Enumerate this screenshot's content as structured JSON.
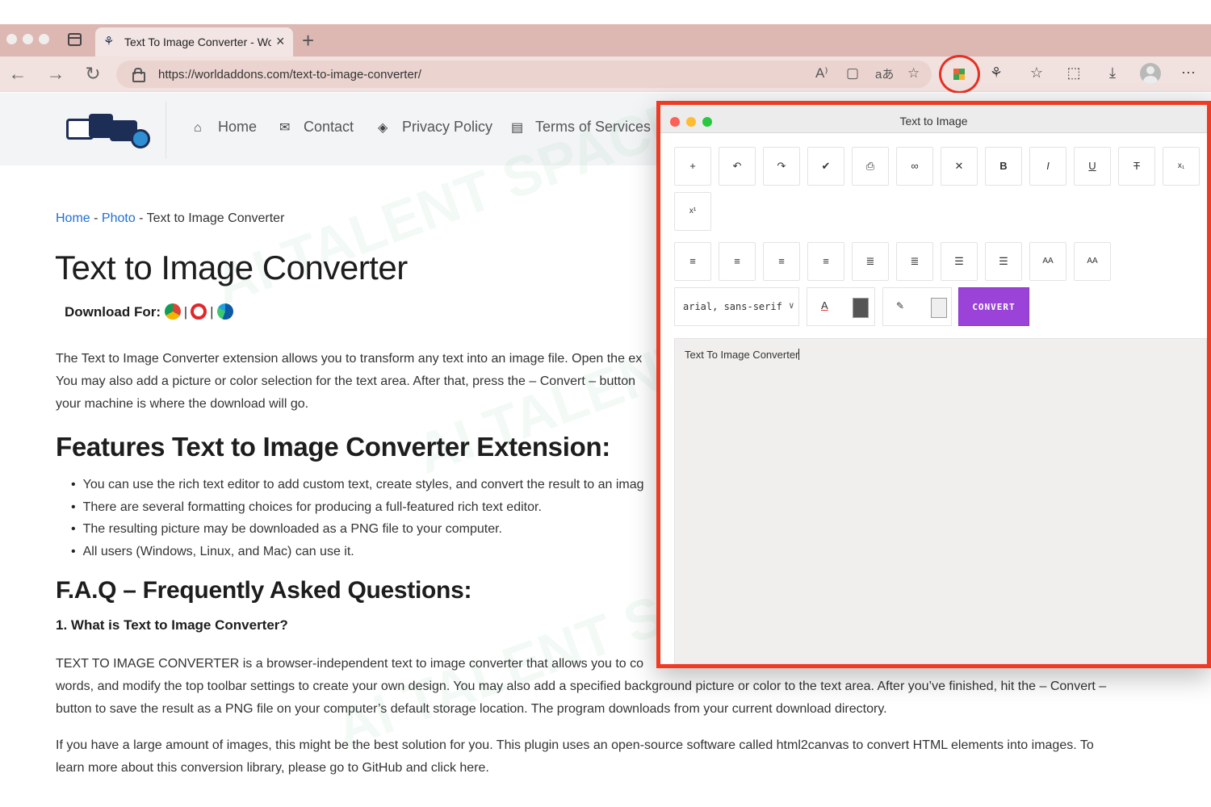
{
  "browser": {
    "tab_title": "Text To Image Converter - Wor",
    "tab_close_glyph": "×",
    "new_tab_glyph": "+",
    "url": "https://worldaddons.com/text-to-image-converter/",
    "back_glyph": "←",
    "forward_glyph": "→",
    "reload_glyph": "↻",
    "address_icons": [
      "read-aloud-icon",
      "immersive-reader-icon",
      "translate-icon",
      "favorite-add-icon"
    ],
    "read_aloud_glyph": "A⁾",
    "immersive_glyph": "▢",
    "translate_glyph": "aあ",
    "favorite_glyph": "☆",
    "toolbar_icons": [
      "text-to-image-extension-icon",
      "extensions-icon",
      "favorites-icon",
      "collections-icon",
      "downloads-icon",
      "profile-icon",
      "more-icon"
    ],
    "extensions_glyph": "⚘",
    "favorites_glyph": "☆",
    "collections_glyph": "⬚",
    "downloads_glyph": "⤓",
    "more_glyph": "⋯",
    "highlight_color": "#e53125"
  },
  "site": {
    "nav": [
      {
        "label": "Home",
        "icon": "home-icon",
        "glyph": "⌂"
      },
      {
        "label": "Contact",
        "icon": "envelope-icon",
        "glyph": "✉"
      },
      {
        "label": "Privacy Policy",
        "icon": "graduation-cap-icon",
        "glyph": "◈"
      },
      {
        "label": "Terms of Services",
        "icon": "document-icon",
        "glyph": "▤"
      }
    ],
    "breadcrumb": {
      "home": "Home",
      "photo": "Photo",
      "current": "Text to Image Converter",
      "separator": " - "
    },
    "title": "Text to Image Converter",
    "download_for": "Download For:",
    "download_browsers": [
      "chrome-icon",
      "opera-icon",
      "edge-icon"
    ],
    "intro": [
      "The Text to Image Converter extension allows you to transform any text into an image file. Open the ex",
      "You may also add a picture or color selection for the text area. After that, press the – Convert – button",
      "your machine is where the download will go."
    ],
    "features_heading": "Features Text to Image Converter Extension:",
    "features": [
      "You can use the rich text editor to add custom text, create styles, and convert the result to an imag",
      "There are several formatting choices for producing a full-featured rich text editor.",
      "The resulting picture may be downloaded as a PNG file to your computer.",
      "All users (Windows, Linux, and Mac) can use it."
    ],
    "faq_heading": "F.A.Q – Frequently Asked Questions:",
    "faq_q1": "1. What is Text to Image Converter?",
    "faq_a1": [
      "TEXT TO IMAGE CONVERTER is a browser-independent text to image converter that allows you to co",
      "words, and modify the top toolbar settings to create your own design. You may also add a specified background picture or color to the text area. After you’ve finished, hit the – Convert –",
      "button to save the result as a PNG file on your computer’s default storage location. The program downloads from your current download directory."
    ],
    "para2": [
      "If you have a large amount of images, this might be the best solution for you. This plugin uses an open-source software called html2canvas to convert HTML elements into images. To",
      "learn more about this conversion library, please go to GitHub and click here."
    ],
    "link_color": "#1f70d4"
  },
  "watermark": "AI TALENT SPACE",
  "popup": {
    "title": "Text to Image",
    "toolbar_row1": [
      {
        "name": "insert-button",
        "glyph": "+"
      },
      {
        "name": "undo-button",
        "glyph": "↶"
      },
      {
        "name": "redo-button",
        "glyph": "↷"
      },
      {
        "name": "check-button",
        "glyph": "✔"
      },
      {
        "name": "print-button",
        "glyph": "⎙"
      },
      {
        "name": "link-button",
        "glyph": "∞"
      },
      {
        "name": "clear-format-button",
        "glyph": "✕"
      },
      {
        "name": "bold-button",
        "glyph": "B",
        "style": "bold"
      },
      {
        "name": "italic-button",
        "glyph": "I",
        "style": "ital"
      },
      {
        "name": "underline-button",
        "glyph": "U",
        "style": "und"
      },
      {
        "name": "strikethrough-button",
        "glyph": "T",
        "style": "strike"
      },
      {
        "name": "subscript-button",
        "glyph": "x₁",
        "style": "small"
      },
      {
        "name": "superscript-button",
        "glyph": "x¹",
        "style": "small"
      }
    ],
    "toolbar_row2": [
      {
        "name": "align-left-button",
        "glyph": "≡"
      },
      {
        "name": "align-center-button",
        "glyph": "≡"
      },
      {
        "name": "align-right-button",
        "glyph": "≡"
      },
      {
        "name": "justify-button",
        "glyph": "≡"
      },
      {
        "name": "indent-button",
        "glyph": "≣"
      },
      {
        "name": "outdent-button",
        "glyph": "≣"
      },
      {
        "name": "bulleted-list-button",
        "glyph": "☰"
      },
      {
        "name": "numbered-list-button",
        "glyph": "☰"
      },
      {
        "name": "decrease-font-button",
        "glyph": "AA",
        "style": "small"
      },
      {
        "name": "increase-font-button",
        "glyph": "AA",
        "style": "small"
      }
    ],
    "font_family": "arial, sans-serif",
    "font_dropdown_glyph": "∨",
    "text_color_glyph": "A",
    "text_color": "#555555",
    "highlight_glyph": "✎",
    "background_color": "#efefef",
    "convert_label": "CONVERT",
    "convert_color": "#9b43d8",
    "editor_text": "Text To Image Converter"
  }
}
